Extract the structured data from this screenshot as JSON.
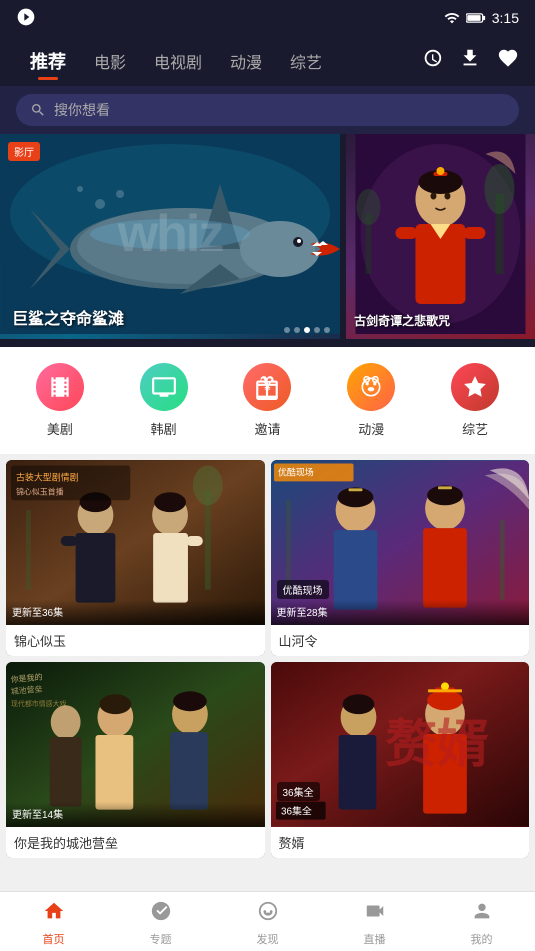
{
  "statusBar": {
    "cameraIcon": "📷",
    "time": "3:15",
    "wifiIcon": "wifi",
    "batteryIcon": "battery"
  },
  "navTabs": [
    {
      "id": "recommend",
      "label": "推荐",
      "active": true
    },
    {
      "id": "movie",
      "label": "电影",
      "active": false
    },
    {
      "id": "tvshow",
      "label": "电视剧",
      "active": false
    },
    {
      "id": "anime",
      "label": "动漫",
      "active": false
    },
    {
      "id": "variety",
      "label": "综艺",
      "active": false
    }
  ],
  "navIcons": {
    "historyLabel": "历史",
    "downloadLabel": "下载",
    "heartLabel": "收藏"
  },
  "search": {
    "placeholder": "搜你想看"
  },
  "heroBanner": {
    "mainTitle": "巨鲨之夺命鲨滩",
    "mainBadge": "影厅",
    "brandText": "whiz",
    "dots": [
      1,
      2,
      3,
      4,
      5
    ],
    "activeDot": 3,
    "sideTitle": "古剑奇谭之悲歌咒"
  },
  "categories": [
    {
      "id": "meiju",
      "label": "美剧",
      "icon": "🎬",
      "colorClass": "icon-meiju"
    },
    {
      "id": "hanju",
      "label": "韩剧",
      "icon": "📺",
      "colorClass": "icon-hanju"
    },
    {
      "id": "invite",
      "label": "邀请",
      "icon": "🎁",
      "colorClass": "icon-invite"
    },
    {
      "id": "dongman",
      "label": "动漫",
      "icon": "🐻",
      "colorClass": "icon-dongman"
    },
    {
      "id": "zongyi",
      "label": "综艺",
      "icon": "🎭",
      "colorClass": "icon-zongyi"
    }
  ],
  "contentCards": [
    {
      "id": "jinxin",
      "title": "锦心似玉",
      "updateText": "更新至36集",
      "badge": "",
      "bgClass": "card-jinxin"
    },
    {
      "id": "shanheling",
      "title": "山河令",
      "updateText": "更新至28集",
      "badge": "优酷现场",
      "bgClass": "card-shanheling"
    },
    {
      "id": "chengchi",
      "title": "你是我的城池营垒",
      "updateText": "更新至14集",
      "badge": "",
      "bgClass": "card-chengchi"
    },
    {
      "id": "zanfu",
      "title": "赘婿",
      "updateText": "",
      "badge": "36集全",
      "bgClass": "card-zanfu"
    }
  ],
  "bottomNav": [
    {
      "id": "home",
      "label": "首页",
      "icon": "🏠",
      "active": true
    },
    {
      "id": "special",
      "label": "专题",
      "icon": "🧭",
      "active": false
    },
    {
      "id": "discover",
      "label": "发现",
      "icon": "😊",
      "active": false
    },
    {
      "id": "live",
      "label": "直播",
      "icon": "📹",
      "active": false
    },
    {
      "id": "mine",
      "label": "我的",
      "icon": "👤",
      "active": false
    }
  ],
  "colors": {
    "accent": "#e84118",
    "navBg": "#1a1a2e",
    "activeTab": "#ffffff"
  }
}
